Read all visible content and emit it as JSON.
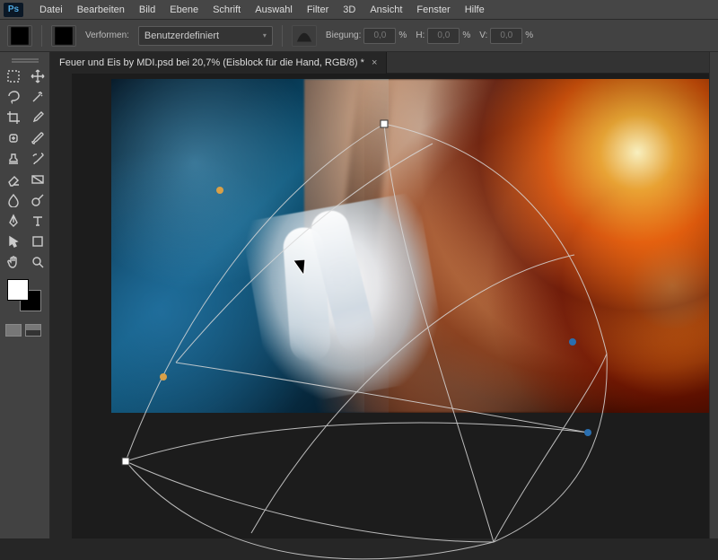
{
  "app": {
    "logo": "Ps"
  },
  "menu": {
    "items": [
      "Datei",
      "Bearbeiten",
      "Bild",
      "Ebene",
      "Schrift",
      "Auswahl",
      "Filter",
      "3D",
      "Ansicht",
      "Fenster",
      "Hilfe"
    ]
  },
  "options": {
    "warp_label": "Verformen:",
    "warp_preset": "Benutzerdefiniert",
    "bend_label": "Biegung:",
    "bend_value": "0,0",
    "percent": "%",
    "h_label": "H:",
    "h_value": "0,0",
    "v_label": "V:",
    "v_value": "0,0"
  },
  "document": {
    "tab_title": "Feuer und Eis by MDI.psd bei 20,7%  (Eisblock für die Hand, RGB/8) *"
  },
  "colors": {
    "ui_bg": "#424242",
    "canvas_bg": "#1c1c1c",
    "accent": "#4fa8e0"
  }
}
